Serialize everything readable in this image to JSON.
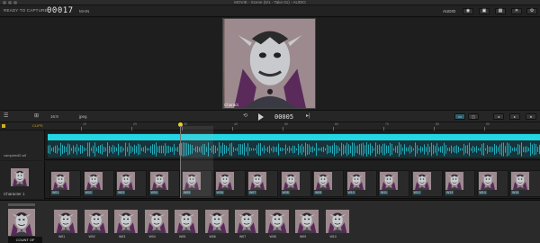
{
  "window": {
    "title": "MOVIE - Scene (5/1 - Take 01) - AUDIO"
  },
  "capture": {
    "label": "READY TO CAPTURE:",
    "frame_count": "00017",
    "scene": "MAIN"
  },
  "topbar": {
    "audio_label": "AUDIO"
  },
  "viewer": {
    "caption": "Charact"
  },
  "controls": {
    "aspect_label": "16:9",
    "format_label": "jpeg",
    "frame_counter": "00005"
  },
  "ruler": {
    "start_label": "CLIPS",
    "tick_labels": [
      "10",
      "20",
      "30",
      "40",
      "50",
      "60",
      "70",
      "80",
      "90"
    ]
  },
  "tracks": {
    "audio_name": "vampiredl2.aif",
    "character_name": "Character 1",
    "clip_labels": [
      "W01",
      "W02",
      "W03",
      "W04",
      "W05",
      "W06",
      "W07",
      "W08",
      "W09",
      "W10",
      "W11",
      "W12",
      "W13",
      "W14",
      "W15"
    ]
  },
  "library": {
    "main_label": "COUNT OF",
    "thumb_labels": [
      "W01",
      "W02",
      "W03",
      "W04",
      "W05",
      "W06",
      "W07",
      "W08",
      "W09",
      "W10"
    ]
  },
  "colors": {
    "accent": "#22d6e3",
    "playhead": "#e8d020"
  }
}
